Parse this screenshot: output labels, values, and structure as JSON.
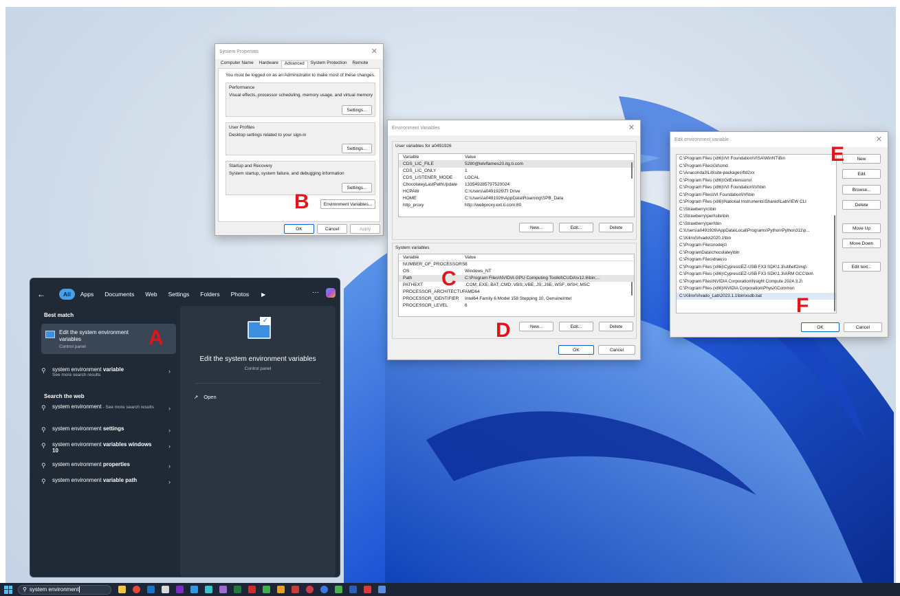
{
  "markers": {
    "a": "A",
    "b": "B",
    "c": "C",
    "d": "D",
    "e": "E",
    "f": "F"
  },
  "system_properties": {
    "title": "System Properties",
    "tabs": [
      "Computer Name",
      "Hardware",
      "Advanced",
      "System Protection",
      "Remote"
    ],
    "admin_note": "You must be logged on as an Administrator to make most of these changes.",
    "performance_title": "Performance",
    "performance_desc": "Visual effects, processor scheduling, memory usage, and virtual memory",
    "profiles_title": "User Profiles",
    "profiles_desc": "Desktop settings related to your sign-in",
    "startup_title": "Startup and Recovery",
    "startup_desc": "System startup, system failure, and debugging information",
    "settings_label": "Settings...",
    "env_button": "Environment Variables...",
    "ok": "OK",
    "cancel": "Cancel",
    "apply": "Apply"
  },
  "env_vars": {
    "title": "Environment Variables",
    "user_section": "User variables for a0491926",
    "system_section": "System variables",
    "col_variable": "Variable",
    "col_value": "Value",
    "user_rows": [
      [
        "CDS_LIC_FILE",
        "5280@lelvflames20.itg.ti.com"
      ],
      [
        "CDS_LIC_ONLY",
        "1"
      ],
      [
        "CDS_LISTENER_MODE",
        "LOCAL"
      ],
      [
        "ChocolateyLastPathUpdate",
        "133549285797520024"
      ],
      [
        "HCPAW",
        "C:\\Users\\a0491926\\TI Drive"
      ],
      [
        "HOME",
        "C:\\Users\\a0491926\\AppData\\Roaming\\SPB_Data"
      ],
      [
        "http_proxy",
        "http://webproxy.ext.ti.com:80"
      ]
    ],
    "system_rows": [
      [
        "NUMBER_OF_PROCESSORS",
        "8"
      ],
      [
        "OS",
        "Windows_NT"
      ],
      [
        "Path",
        "C:\\Program Files\\NVIDIA GPU Computing Toolkit\\CUDA\\v12.6\\bin;..."
      ],
      [
        "PATHEXT",
        ".COM;.EXE;.BAT;.CMD;.VBS;.VBE;.JS;.JSE;.WSF;.WSH;.MSC"
      ],
      [
        "PROCESSOR_ARCHITECTURE",
        "AMD64"
      ],
      [
        "PROCESSOR_IDENTIFIER",
        "Intel64 Family 6 Model 158 Stepping 10, GenuineIntel"
      ],
      [
        "PROCESSOR_LEVEL",
        "6"
      ]
    ],
    "new": "New...",
    "edit": "Edit...",
    "delete": "Delete",
    "ok": "OK",
    "cancel": "Cancel"
  },
  "edit_env": {
    "title": "Edit environment variable",
    "paths": [
      "C:\\Program Files (x86)\\IVI Foundation\\VISA\\WinNT\\Bin",
      "C:\\Program Files\\Git\\cmd",
      "C:\\Anaconda3\\Lib\\site-packages\\ftd2xx",
      "C:\\Program Files (x86)\\GitExtensions\\",
      "C:\\Program Files (x86)\\IVI Foundation\\IVI\\bin",
      "C:\\Program Files\\IVI Foundation\\IVI\\bin",
      "C:\\Program Files (x86)\\National Instruments\\Shared\\LabVIEW CLI",
      "C:\\Strawberry\\c\\bin",
      "C:\\Strawberry\\perl\\site\\bin",
      "C:\\Strawberry\\perl\\bin",
      "C:\\Users\\a0491926\\AppData\\Local\\Programs\\Python\\Python311\\p...",
      "C:\\Xilinx\\Vivado\\2020.1\\bin",
      "C:\\Program Files\\nodejs\\",
      "C:\\ProgramData\\chocolatey\\bin",
      "C:\\Program Files\\draw.io",
      "C:\\Program Files (x86)\\Cypress\\EZ-USB FX3 SDK\\1.3\\util\\elf2img\\",
      "C:\\Program Files (x86)\\Cypress\\EZ-USB FX3 SDK\\1.3\\ARM GCC\\bin\\",
      "C:\\Program Files\\NVIDIA Corporation\\Nsight Compute 2024.3.2\\",
      "C:\\Program Files (x86)\\NVIDIA Corporation\\PhysX\\Common",
      "C:\\Xilinx\\Vivado_Lab\\2023.1.1\\bin\\xsdb.bat"
    ],
    "buttons": [
      "New",
      "Edit",
      "Browse...",
      "Delete",
      "Move Up",
      "Move Down",
      "Edit text..."
    ],
    "ok": "OK",
    "cancel": "Cancel"
  },
  "start_menu": {
    "filters": [
      "All",
      "Apps",
      "Documents",
      "Web",
      "Settings",
      "Folders",
      "Photos"
    ],
    "best_match": "Best match",
    "best_title": "Edit the system environment variables",
    "best_sub": "Control panel",
    "item_variable": "system environment variable",
    "item_variable_sub": "See more search results",
    "search_web": "Search the web",
    "web_items": [
      {
        "pre": "system environment",
        "bold": "",
        "sub": " - See more search results"
      },
      {
        "pre": "system environment ",
        "bold": "settings",
        "sub": ""
      },
      {
        "pre": "system environment ",
        "bold": "variables windows 10",
        "sub": ""
      },
      {
        "pre": "system environment ",
        "bold": "properties",
        "sub": ""
      },
      {
        "pre": "system environment ",
        "bold": "variable path",
        "sub": ""
      }
    ],
    "detail_title": "Edit the system environment variables",
    "detail_sub": "Control panel",
    "open": "Open"
  },
  "taskbar": {
    "search_text": "system environment"
  }
}
